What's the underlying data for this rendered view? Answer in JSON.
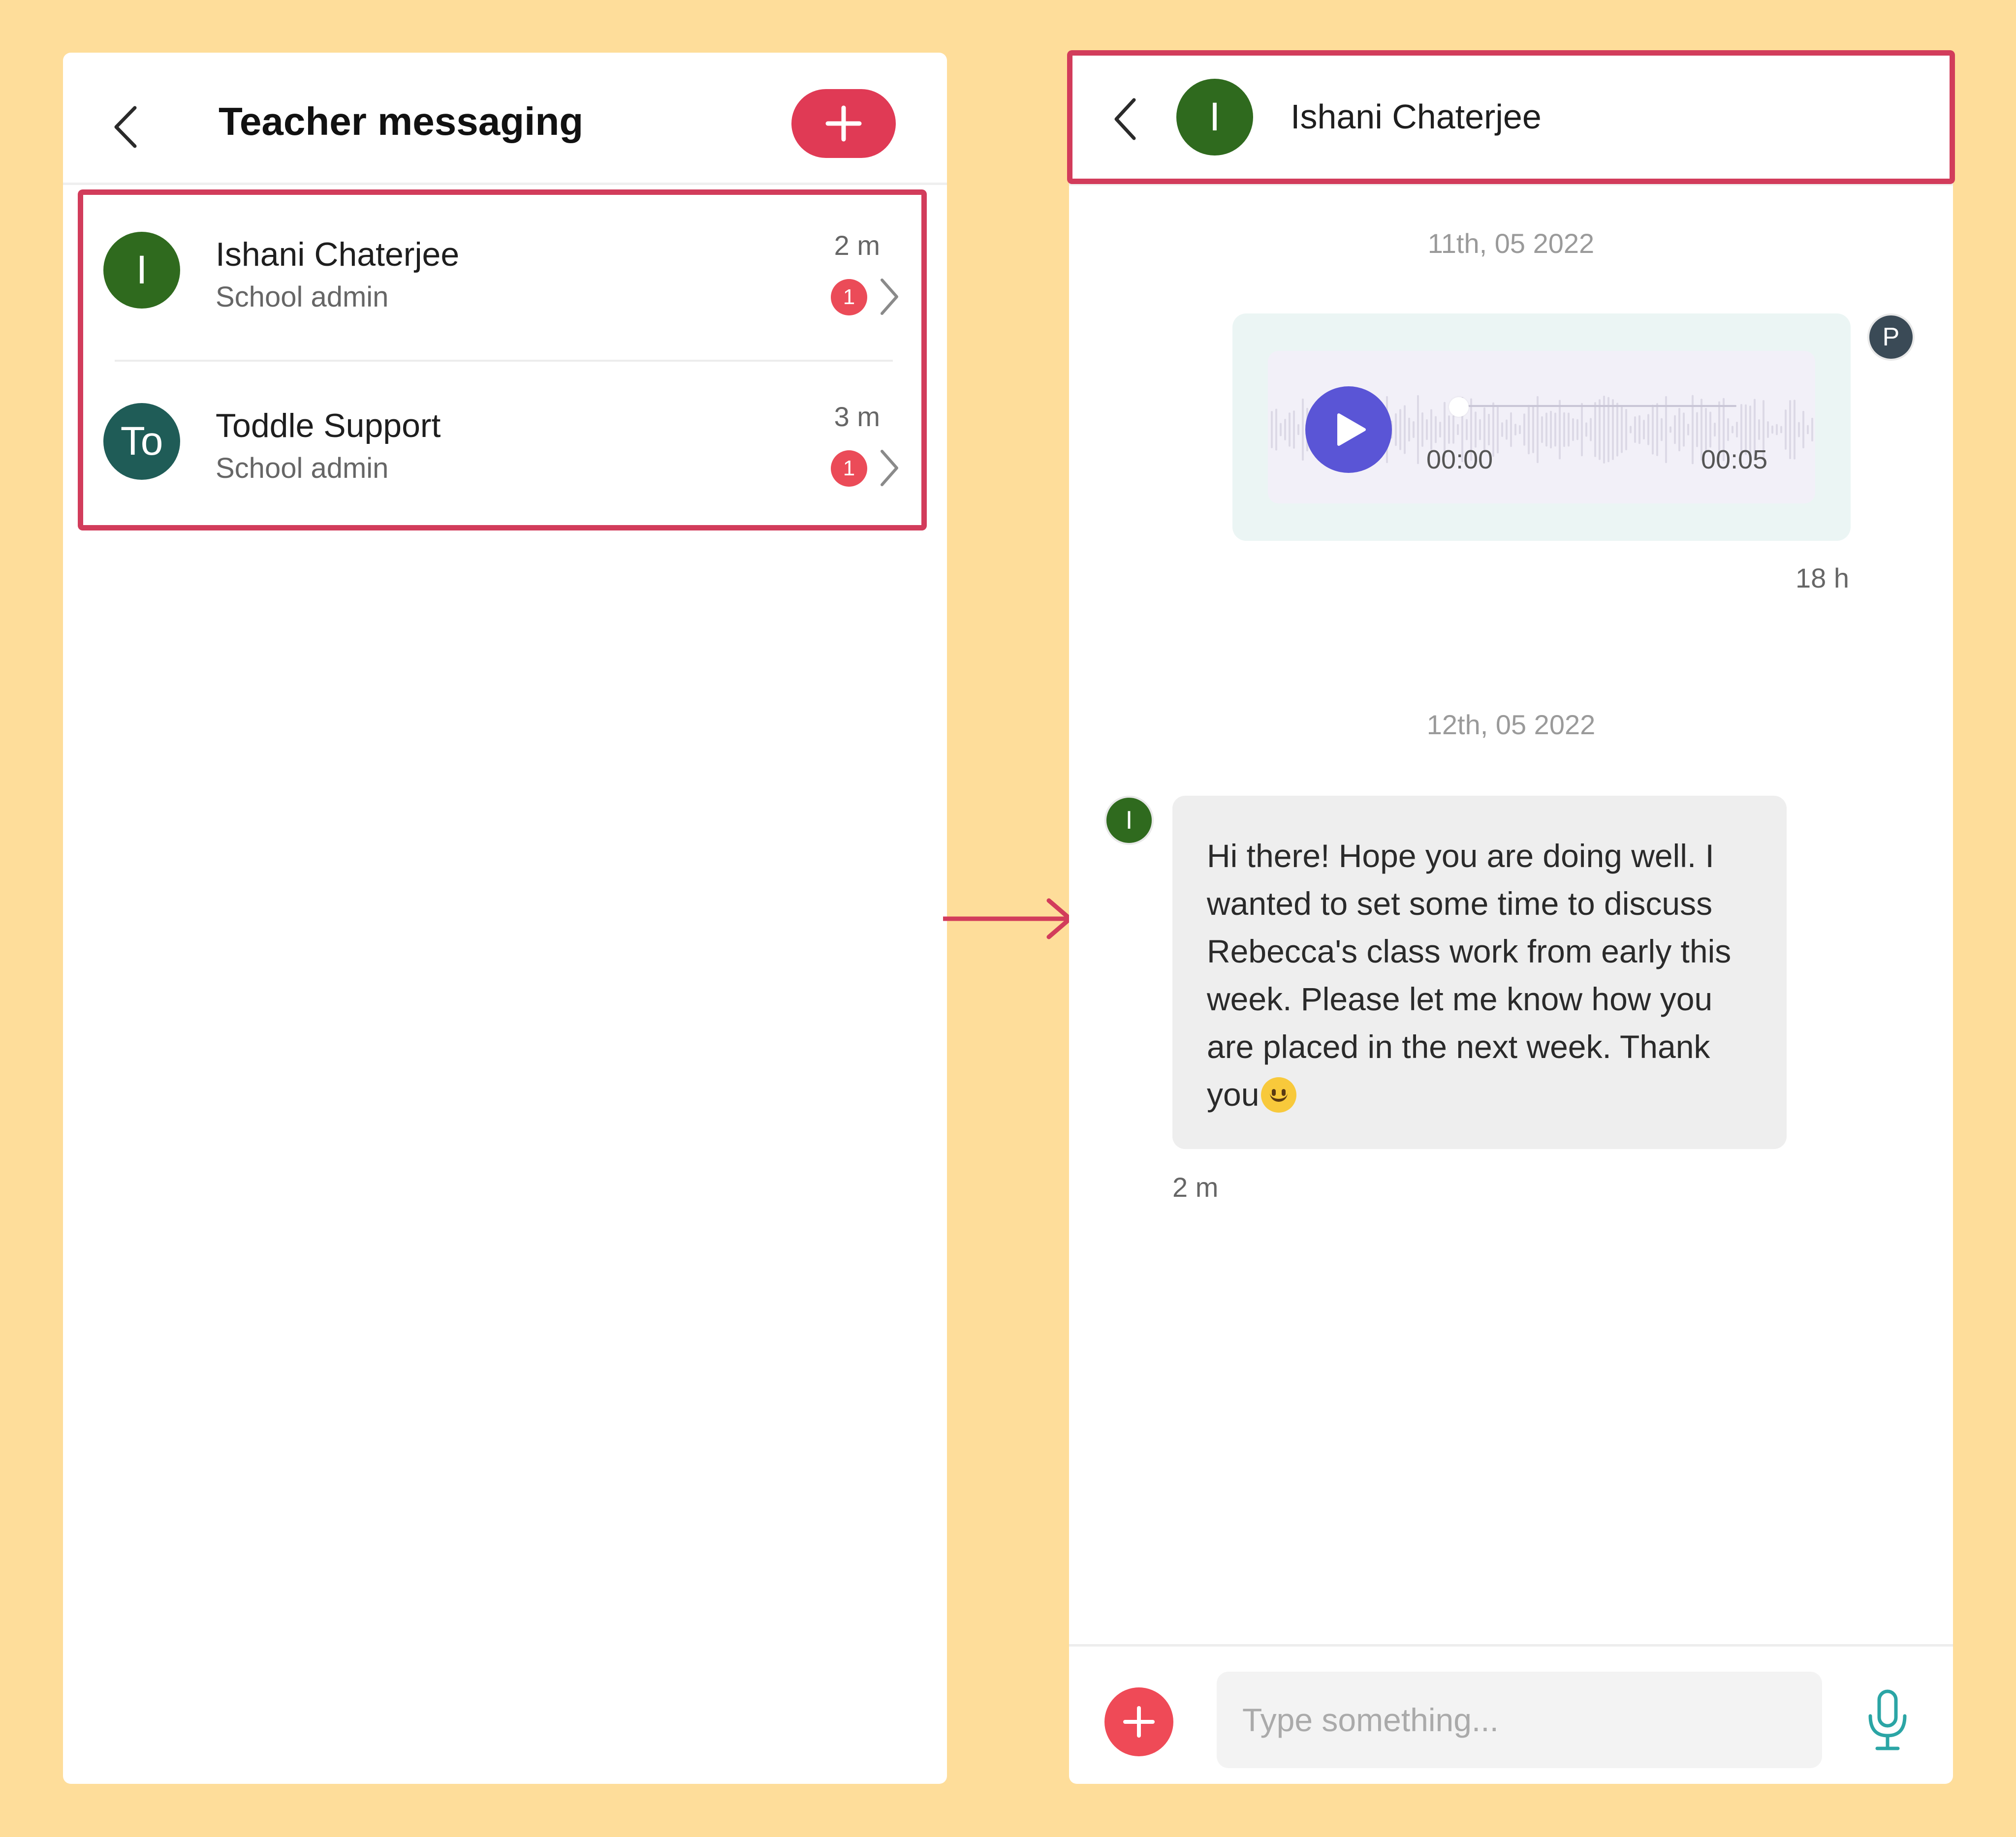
{
  "left_screen": {
    "title": "Teacher messaging",
    "new_button_icon": "plus-icon",
    "back_icon": "chevron-left-icon",
    "conversations": [
      {
        "avatar_text": "I",
        "avatar_color": "#2F6A1E",
        "name": "Ishani Chaterjee",
        "role": "School admin",
        "time": "2 m",
        "unread": "1"
      },
      {
        "avatar_text": "To",
        "avatar_color": "#1F5C57",
        "name": "Toddle Support",
        "role": "School admin",
        "time": "3 m",
        "unread": "1"
      }
    ]
  },
  "right_screen": {
    "contact_name": "Ishani Chaterjee",
    "contact_avatar_text": "I",
    "contact_avatar_color": "#2F6A1E",
    "messages": [
      {
        "date": "11th, 05 2022",
        "type": "audio",
        "sender_avatar_text": "P",
        "sender_avatar_color": "#3A4A56",
        "current_time": "00:00",
        "duration": "00:05",
        "progress": 0,
        "timestamp": "18 h"
      },
      {
        "date": "12th, 05 2022",
        "type": "text",
        "sender_avatar_text": "I",
        "text": "Hi there! Hope you are doing well. I wanted to set some time to discuss Rebecca's class work from early this week. Please let me know how you are placed in the next week. Thank you",
        "emoji": "slightly-smiling-face",
        "timestamp": "2 m"
      }
    ],
    "input_placeholder": "Type something...",
    "attach_icon": "plus-icon",
    "mic_icon": "microphone-icon"
  },
  "colors": {
    "background": "#FEDD9A",
    "highlight": "#D23C5B",
    "primary_button": "#E03A55",
    "badge": "#EB4B58",
    "play_button": "#5A55D6",
    "audio_bubble": "#EBF5F4",
    "mic": "#2BA5A5"
  }
}
